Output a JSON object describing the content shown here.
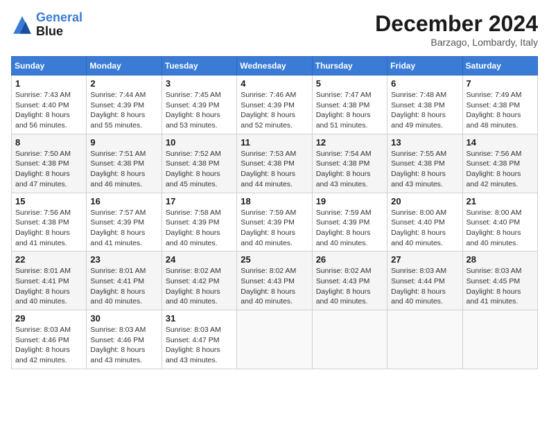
{
  "header": {
    "logo_line1": "General",
    "logo_line2": "Blue",
    "month_title": "December 2024",
    "subtitle": "Barzago, Lombardy, Italy"
  },
  "days_of_week": [
    "Sunday",
    "Monday",
    "Tuesday",
    "Wednesday",
    "Thursday",
    "Friday",
    "Saturday"
  ],
  "weeks": [
    [
      {
        "day": "1",
        "sunrise": "7:43 AM",
        "sunset": "4:40 PM",
        "daylight": "8 hours and 56 minutes."
      },
      {
        "day": "2",
        "sunrise": "7:44 AM",
        "sunset": "4:39 PM",
        "daylight": "8 hours and 55 minutes."
      },
      {
        "day": "3",
        "sunrise": "7:45 AM",
        "sunset": "4:39 PM",
        "daylight": "8 hours and 53 minutes."
      },
      {
        "day": "4",
        "sunrise": "7:46 AM",
        "sunset": "4:39 PM",
        "daylight": "8 hours and 52 minutes."
      },
      {
        "day": "5",
        "sunrise": "7:47 AM",
        "sunset": "4:38 PM",
        "daylight": "8 hours and 51 minutes."
      },
      {
        "day": "6",
        "sunrise": "7:48 AM",
        "sunset": "4:38 PM",
        "daylight": "8 hours and 49 minutes."
      },
      {
        "day": "7",
        "sunrise": "7:49 AM",
        "sunset": "4:38 PM",
        "daylight": "8 hours and 48 minutes."
      }
    ],
    [
      {
        "day": "8",
        "sunrise": "7:50 AM",
        "sunset": "4:38 PM",
        "daylight": "8 hours and 47 minutes."
      },
      {
        "day": "9",
        "sunrise": "7:51 AM",
        "sunset": "4:38 PM",
        "daylight": "8 hours and 46 minutes."
      },
      {
        "day": "10",
        "sunrise": "7:52 AM",
        "sunset": "4:38 PM",
        "daylight": "8 hours and 45 minutes."
      },
      {
        "day": "11",
        "sunrise": "7:53 AM",
        "sunset": "4:38 PM",
        "daylight": "8 hours and 44 minutes."
      },
      {
        "day": "12",
        "sunrise": "7:54 AM",
        "sunset": "4:38 PM",
        "daylight": "8 hours and 43 minutes."
      },
      {
        "day": "13",
        "sunrise": "7:55 AM",
        "sunset": "4:38 PM",
        "daylight": "8 hours and 43 minutes."
      },
      {
        "day": "14",
        "sunrise": "7:56 AM",
        "sunset": "4:38 PM",
        "daylight": "8 hours and 42 minutes."
      }
    ],
    [
      {
        "day": "15",
        "sunrise": "7:56 AM",
        "sunset": "4:38 PM",
        "daylight": "8 hours and 41 minutes."
      },
      {
        "day": "16",
        "sunrise": "7:57 AM",
        "sunset": "4:39 PM",
        "daylight": "8 hours and 41 minutes."
      },
      {
        "day": "17",
        "sunrise": "7:58 AM",
        "sunset": "4:39 PM",
        "daylight": "8 hours and 40 minutes."
      },
      {
        "day": "18",
        "sunrise": "7:59 AM",
        "sunset": "4:39 PM",
        "daylight": "8 hours and 40 minutes."
      },
      {
        "day": "19",
        "sunrise": "7:59 AM",
        "sunset": "4:39 PM",
        "daylight": "8 hours and 40 minutes."
      },
      {
        "day": "20",
        "sunrise": "8:00 AM",
        "sunset": "4:40 PM",
        "daylight": "8 hours and 40 minutes."
      },
      {
        "day": "21",
        "sunrise": "8:00 AM",
        "sunset": "4:40 PM",
        "daylight": "8 hours and 40 minutes."
      }
    ],
    [
      {
        "day": "22",
        "sunrise": "8:01 AM",
        "sunset": "4:41 PM",
        "daylight": "8 hours and 40 minutes."
      },
      {
        "day": "23",
        "sunrise": "8:01 AM",
        "sunset": "4:41 PM",
        "daylight": "8 hours and 40 minutes."
      },
      {
        "day": "24",
        "sunrise": "8:02 AM",
        "sunset": "4:42 PM",
        "daylight": "8 hours and 40 minutes."
      },
      {
        "day": "25",
        "sunrise": "8:02 AM",
        "sunset": "4:43 PM",
        "daylight": "8 hours and 40 minutes."
      },
      {
        "day": "26",
        "sunrise": "8:02 AM",
        "sunset": "4:43 PM",
        "daylight": "8 hours and 40 minutes."
      },
      {
        "day": "27",
        "sunrise": "8:03 AM",
        "sunset": "4:44 PM",
        "daylight": "8 hours and 40 minutes."
      },
      {
        "day": "28",
        "sunrise": "8:03 AM",
        "sunset": "4:45 PM",
        "daylight": "8 hours and 41 minutes."
      }
    ],
    [
      {
        "day": "29",
        "sunrise": "8:03 AM",
        "sunset": "4:46 PM",
        "daylight": "8 hours and 42 minutes."
      },
      {
        "day": "30",
        "sunrise": "8:03 AM",
        "sunset": "4:46 PM",
        "daylight": "8 hours and 43 minutes."
      },
      {
        "day": "31",
        "sunrise": "8:03 AM",
        "sunset": "4:47 PM",
        "daylight": "8 hours and 43 minutes."
      },
      null,
      null,
      null,
      null
    ]
  ]
}
